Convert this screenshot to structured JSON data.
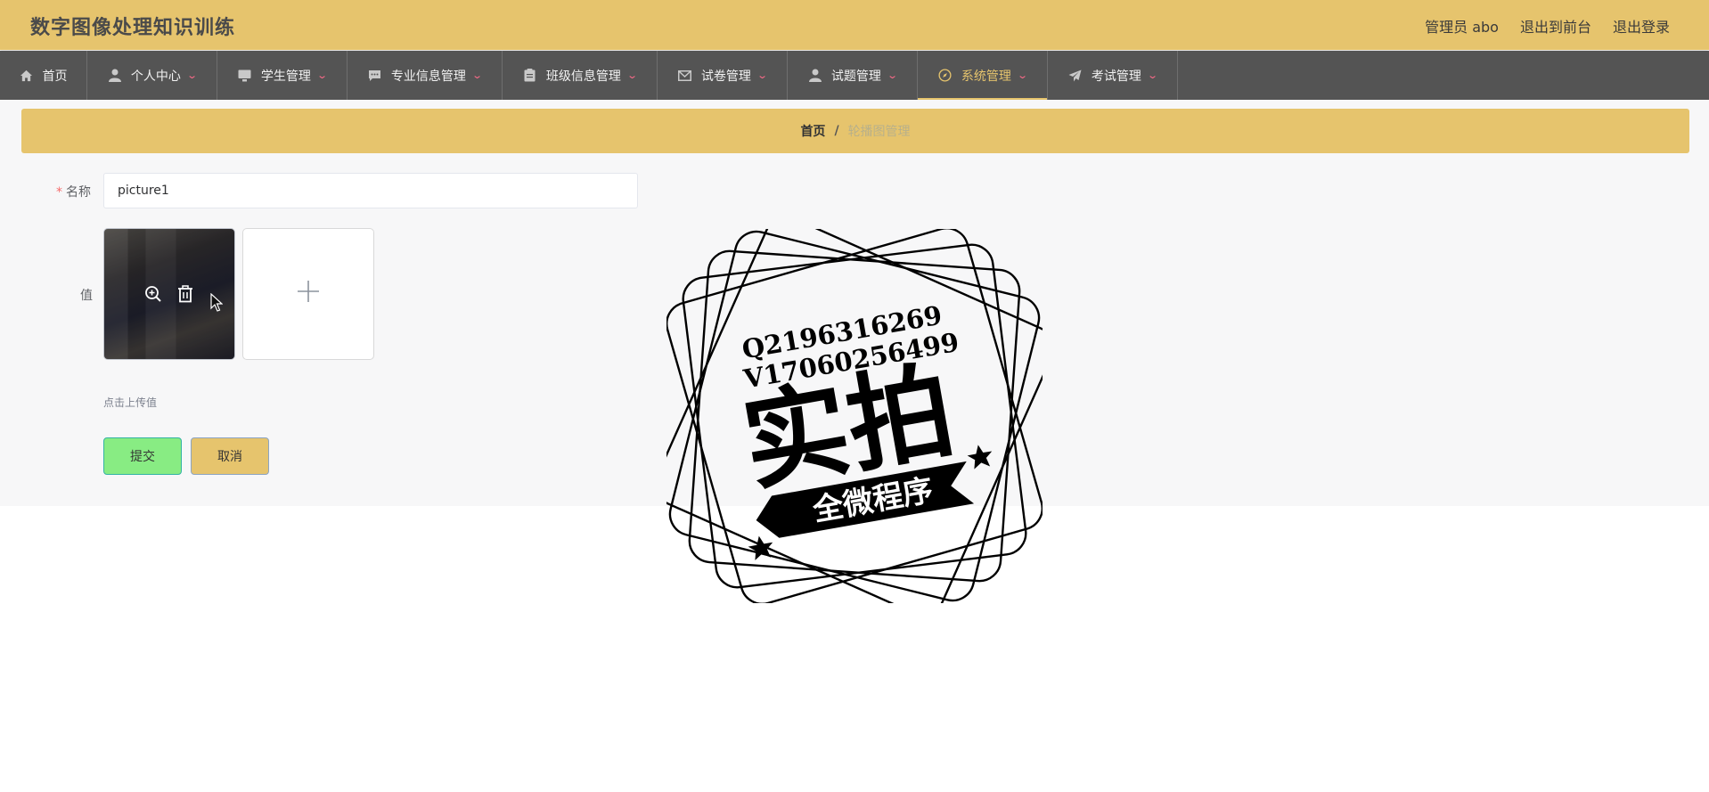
{
  "app": {
    "title": "数字图像处理知识训练"
  },
  "header": {
    "user": "管理员 abo",
    "front_link": "退出到前台",
    "logout_link": "退出登录"
  },
  "nav": {
    "items": [
      {
        "label": "首页",
        "icon": "home-icon",
        "dropdown": false
      },
      {
        "label": "个人中心",
        "icon": "user-icon",
        "dropdown": true
      },
      {
        "label": "学生管理",
        "icon": "monitor-icon",
        "dropdown": true
      },
      {
        "label": "专业信息管理",
        "icon": "chat-icon",
        "dropdown": true
      },
      {
        "label": "班级信息管理",
        "icon": "clipboard-icon",
        "dropdown": true
      },
      {
        "label": "试卷管理",
        "icon": "mail-icon",
        "dropdown": true
      },
      {
        "label": "试题管理",
        "icon": "user-icon",
        "dropdown": true
      },
      {
        "label": "系统管理",
        "icon": "compass-icon",
        "dropdown": true,
        "active": true
      },
      {
        "label": "考试管理",
        "icon": "send-icon",
        "dropdown": true
      }
    ]
  },
  "breadcrumb": {
    "home": "首页",
    "separator": "/",
    "current": "轮播图管理"
  },
  "form": {
    "name_label": "名称",
    "name_value": "picture1",
    "value_label": "值",
    "upload_hint": "点击上传值",
    "submit_label": "提交",
    "cancel_label": "取消"
  },
  "watermark": {
    "line1": "Q2196316269",
    "line2": "V17060256499",
    "main": "实拍",
    "banner": "全微程序"
  },
  "colors": {
    "header_bg": "#e6c46d",
    "nav_bg": "#545454",
    "active_accent": "#e6c46d",
    "submit_bg": "#88ec83",
    "cancel_bg": "#e6c46d",
    "required": "#f56c6c"
  }
}
